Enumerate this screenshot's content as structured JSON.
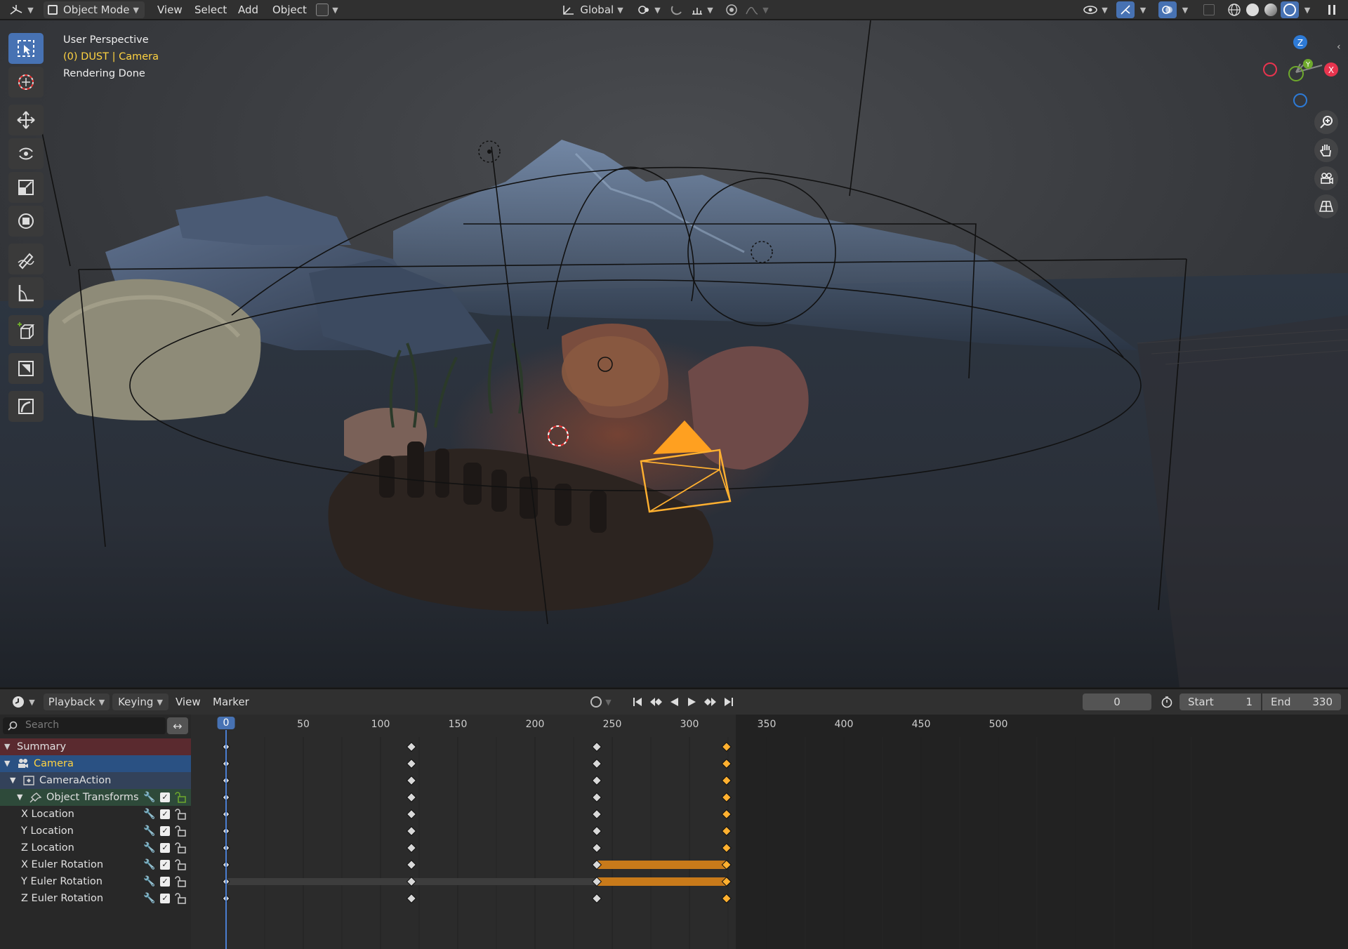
{
  "header": {
    "mode_label": "Object Mode",
    "menus": [
      "View",
      "Select",
      "Add",
      "Object"
    ],
    "orientation_label": "Global"
  },
  "viewport": {
    "view_name": "User Perspective",
    "frame_prefix": "(0) DUST",
    "object_name": "Camera",
    "status": "Rendering Done",
    "gizmo": {
      "x_label": "X",
      "y_label": "Y",
      "z_label": "Z"
    },
    "colors": {
      "x_axis": "#e8344e",
      "y_axis": "#6ea92c",
      "z_axis": "#2d7ad6",
      "camera_selected": "#ffb030"
    }
  },
  "timeline": {
    "menus": [
      "Playback",
      "Keying",
      "View",
      "Marker"
    ],
    "current_frame": "0",
    "start_label": "Start",
    "start_value": "1",
    "end_label": "End",
    "end_value": "330",
    "search_placeholder": "Search",
    "ruler_ticks": [
      "0",
      "50",
      "100",
      "150",
      "200",
      "250",
      "300",
      "350",
      "400",
      "450",
      "500"
    ],
    "channels": [
      {
        "label": "Summary",
        "type": "summary"
      },
      {
        "label": "Camera",
        "type": "object"
      },
      {
        "label": "CameraAction",
        "type": "action"
      },
      {
        "label": "Object Transforms",
        "type": "group"
      },
      {
        "label": "X Location",
        "type": "fcurve"
      },
      {
        "label": "Y Location",
        "type": "fcurve"
      },
      {
        "label": "Z Location",
        "type": "fcurve"
      },
      {
        "label": "X Euler Rotation",
        "type": "fcurve"
      },
      {
        "label": "Y Euler Rotation",
        "type": "fcurve"
      },
      {
        "label": "Z Euler Rotation",
        "type": "fcurve"
      }
    ],
    "keyframe_frames": [
      0,
      120,
      240,
      324
    ],
    "selected_frame": 324,
    "holds": [
      {
        "channel": "X Euler Rotation",
        "from": 240,
        "to": 324
      },
      {
        "channel": "Y Euler Rotation",
        "from": 240,
        "to": 324
      }
    ]
  }
}
